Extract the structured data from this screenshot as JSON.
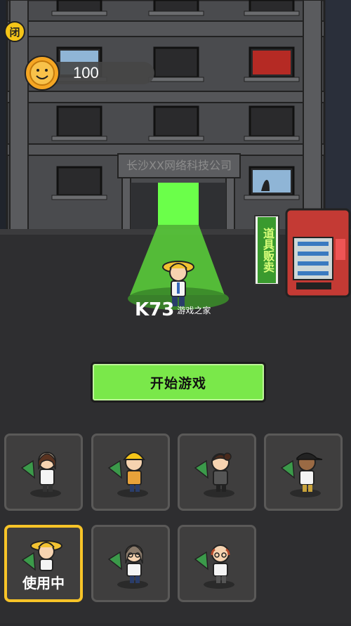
{
  "close_button": {
    "label": "闭"
  },
  "coins": {
    "count": "100"
  },
  "building": {
    "sign_text": "长沙XX网络科技公司"
  },
  "vending": {
    "sign_text": "道具贩卖"
  },
  "watermark": {
    "text": "K73",
    "sub": "游戏之家"
  },
  "start_button": {
    "label": "开始游戏"
  },
  "characters": [
    {
      "name": "girl-office"
    },
    {
      "name": "construction-worker"
    },
    {
      "name": "woman-hairbun"
    },
    {
      "name": "boy-cap"
    },
    {
      "name": "straw-hat-boy",
      "status": "使用中"
    },
    {
      "name": "girl-glasses"
    },
    {
      "name": "bald-old-man"
    }
  ],
  "colors": {
    "accent": "#7ae84a",
    "active_border": "#f7c428",
    "coin": "#f5a623"
  }
}
